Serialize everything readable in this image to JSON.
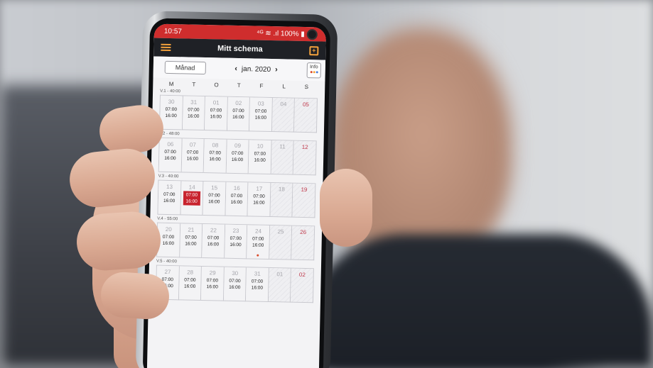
{
  "status_bar": {
    "time": "10:57",
    "indicators": "⁴ᴳ ≋ .ıl 100% ▮"
  },
  "app_bar": {
    "title": "Mitt schema",
    "menu_icon": "hamburger-menu-icon",
    "calendar_icon": "calendar-add-icon"
  },
  "toolbar": {
    "view_button": "Månad",
    "month_label": "jan. 2020",
    "prev": "‹",
    "next": "›",
    "info_button": "Info"
  },
  "weekdays": [
    "M",
    "T",
    "O",
    "T",
    "F",
    "L",
    "S"
  ],
  "colors": {
    "accent_red": "#cf2d2d",
    "today_red": "#c8232e",
    "appbar_dark": "#1f2126",
    "icon_orange": "#f4a23c",
    "sunday_red": "#c0394b"
  },
  "weeks": [
    {
      "label": "V.1 - 40:00",
      "days": [
        {
          "num": "30",
          "start": "07:00",
          "end": "16:00"
        },
        {
          "num": "31",
          "start": "07:00",
          "end": "16:00"
        },
        {
          "num": "01",
          "start": "07:00",
          "end": "16:00"
        },
        {
          "num": "02",
          "start": "07:00",
          "end": "16:00"
        },
        {
          "num": "03",
          "start": "07:00",
          "end": "16:00"
        },
        {
          "num": "04",
          "start": "",
          "end": ""
        },
        {
          "num": "05",
          "start": "",
          "end": ""
        }
      ]
    },
    {
      "label": "V.2 - 48:00",
      "days": [
        {
          "num": "06",
          "start": "07:00",
          "end": "16:00"
        },
        {
          "num": "07",
          "start": "07:00",
          "end": "16:00"
        },
        {
          "num": "08",
          "start": "07:00",
          "end": "16:00"
        },
        {
          "num": "09",
          "start": "07:00",
          "end": "16:00"
        },
        {
          "num": "10",
          "start": "07:00",
          "end": "16:00"
        },
        {
          "num": "11",
          "start": "",
          "end": ""
        },
        {
          "num": "12",
          "start": "",
          "end": ""
        }
      ]
    },
    {
      "label": "V.3 - 40:00",
      "days": [
        {
          "num": "13",
          "start": "07:00",
          "end": "16:00"
        },
        {
          "num": "14",
          "start": "07:00",
          "end": "16:00"
        },
        {
          "num": "15",
          "start": "07:00",
          "end": "16:00"
        },
        {
          "num": "16",
          "start": "07:00",
          "end": "16:00"
        },
        {
          "num": "17",
          "start": "07:00",
          "end": "16:00"
        },
        {
          "num": "18",
          "start": "",
          "end": ""
        },
        {
          "num": "19",
          "start": "",
          "end": ""
        }
      ]
    },
    {
      "label": "V.4 - 55:00",
      "days": [
        {
          "num": "20",
          "start": "07:00",
          "end": "16:00"
        },
        {
          "num": "21",
          "start": "07:00",
          "end": "16:00"
        },
        {
          "num": "22",
          "start": "07:00",
          "end": "16:00"
        },
        {
          "num": "23",
          "start": "07:00",
          "end": "16:00"
        },
        {
          "num": "24",
          "start": "07:00",
          "end": "16:00"
        },
        {
          "num": "25",
          "start": "",
          "end": ""
        },
        {
          "num": "26",
          "start": "",
          "end": ""
        }
      ]
    },
    {
      "label": "V.5 - 40:00",
      "days": [
        {
          "num": "27",
          "start": "07:00",
          "end": "16:00"
        },
        {
          "num": "28",
          "start": "07:00",
          "end": "16:00"
        },
        {
          "num": "29",
          "start": "07:00",
          "end": "16:00"
        },
        {
          "num": "30",
          "start": "07:00",
          "end": "16:00"
        },
        {
          "num": "31",
          "start": "07:00",
          "end": "16:00"
        },
        {
          "num": "01",
          "start": "",
          "end": ""
        },
        {
          "num": "02",
          "start": "",
          "end": ""
        }
      ]
    }
  ],
  "today": {
    "week": 2,
    "day": 1
  },
  "marked_day": {
    "week": 3,
    "day": 4
  }
}
